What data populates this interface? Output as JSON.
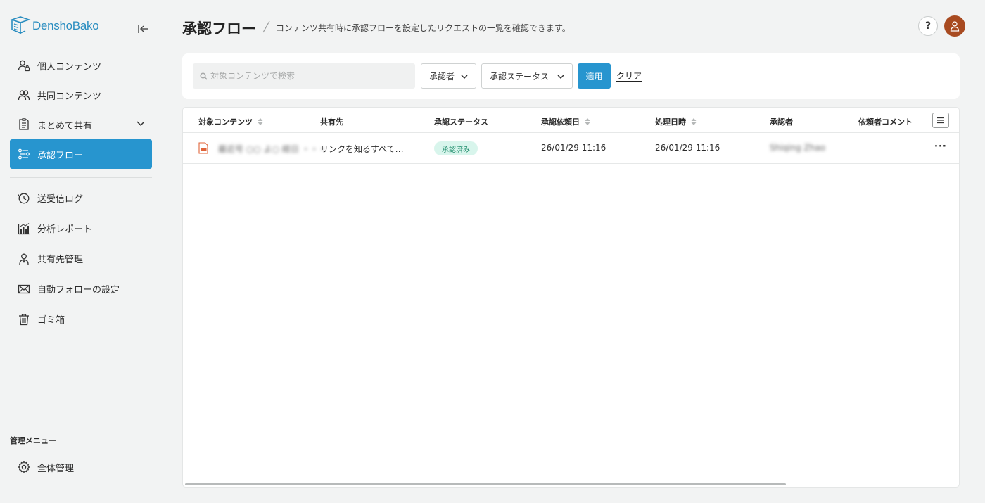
{
  "app": {
    "logo_text": "DenshoBako"
  },
  "sidebar": {
    "items": [
      {
        "label": "個人コンテンツ",
        "icon": "person-lock-icon"
      },
      {
        "label": "共同コンテンツ",
        "icon": "people-icon"
      },
      {
        "label": "まとめて共有",
        "icon": "bulk-share-icon"
      },
      {
        "label": "承認フロー",
        "icon": "approval-flow-icon"
      },
      {
        "label": "送受信ログ",
        "icon": "history-icon"
      },
      {
        "label": "分析レポート",
        "icon": "bar-chart-icon"
      },
      {
        "label": "共有先管理",
        "icon": "contact-icon"
      },
      {
        "label": "自動フォローの設定",
        "icon": "mail-icon"
      },
      {
        "label": "ゴミ箱",
        "icon": "trash-icon"
      }
    ],
    "admin_label": "管理メニュー",
    "admin_items": [
      {
        "label": "全体管理",
        "icon": "gear-icon"
      }
    ],
    "active_index": 3
  },
  "header": {
    "title": "承認フロー",
    "description": "コンテンツ共有時に承認フローを設定したリクエストの一覧を確認できます。",
    "help_label": "?"
  },
  "filters": {
    "search_placeholder": "対象コンテンツで検索",
    "approver_label": "承認者",
    "status_label": "承認ステータス",
    "apply_label": "適用",
    "clear_label": "クリア"
  },
  "table": {
    "columns": [
      "対象コンテンツ",
      "共有先",
      "承認ステータス",
      "承認依頼日",
      "処理日時",
      "承認者",
      "依頼者コメント"
    ],
    "rows": [
      {
        "content": "最近号 ○○ よ○ 経日 ・・・",
        "share_to": "リンクを知るすべて…",
        "status": "承認済み",
        "requested": "26/01/29 11:16",
        "processed": "26/01/29 11:16",
        "approver": "Shiqing Zhao",
        "comment": ""
      }
    ]
  },
  "colors": {
    "accent": "#2795cf",
    "approved_bg": "#d8f5ec",
    "approved_text": "#1a8a68",
    "avatar": "#a84a20"
  }
}
